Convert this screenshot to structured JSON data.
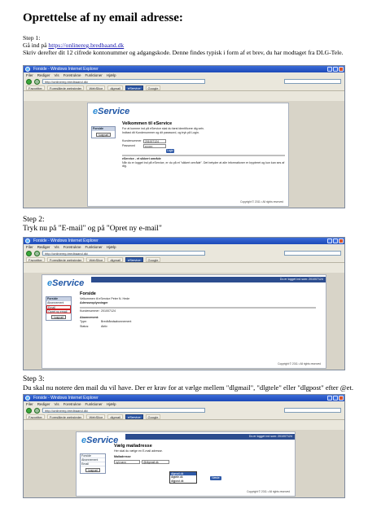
{
  "doc": {
    "title": "Oprettelse af ny email adresse:",
    "step1": {
      "heading": "Step 1:",
      "line1_prefix": "Gå ind på ",
      "link": "https://onlinereg.bredbaand.dk",
      "line2": "Skriv derefter dit 12 cifrede kontonummer og adgangskode. Denne findes typisk i form af et brev, du har modtaget fra DLG-Tele."
    },
    "step2": {
      "heading": "Step 2:",
      "instruction": "Tryk nu på \"E-mail\" og på \"Opret ny e-mail\""
    },
    "step3": {
      "heading": "Step 3:",
      "instruction": "Du skal nu notere den mail du vil have. Der er krav for at vælge mellem \"dlgmail\", \"dlgtele\" eller \"dlgpost\" efter @et."
    }
  },
  "browser": {
    "window_title": "Forside - Windows Internet Explorer",
    "menu": [
      "Filer",
      "Rediger",
      "Vis",
      "Foretrukne",
      "Funktioner",
      "Hjælp"
    ],
    "address": "http://onlinereg.bredbaand.dk/",
    "links": [
      "Favoritter",
      "Foreslåede websteder",
      "WebSlice",
      "dlgmail"
    ],
    "tabs": [
      "eService",
      "Google"
    ]
  },
  "shot1": {
    "logo_e": "e",
    "logo_rest": "Service",
    "side_head": "Forside",
    "logout": "Log ud",
    "welcome": "Velkommen til eService",
    "intro": "For at komme ind på eService skal du først identificere dig selv.",
    "hint": "Indtast dit Kundenummer og dit password, og tryk på Login.",
    "label_user": "Kundenummer",
    "value_user": "201007124",
    "label_pass": "Password",
    "value_pass": "••••••••",
    "login": "Login",
    "notice_title": "eService - et sikkert område",
    "notice": "Når du er logget ind på eService, er du på et \"sikkert område\". Det betyder at alle informationer er krypteret og kun kan ses af dig.",
    "copyright": "Copyright © 2011 • All rights reserved"
  },
  "shot2": {
    "logo_e": "e",
    "logo_rest": "Service",
    "header_right": "Du er logget ind som: 201007124",
    "side": [
      "Forside",
      "Abonnement",
      "Email",
      "Opret ny email"
    ],
    "logout": "Log ud",
    "title": "Forside",
    "welcome": "Velkommen til eService Peter N. Hede",
    "section": "Adresseoplysninger",
    "label_customer": "Kundenummer:",
    "value_customer": "201007124",
    "section2": "Abonnement:",
    "type_label": "Type:",
    "type_value": "Bredbåndsabonnement",
    "status_label": "Status:",
    "status_value": "Aktiv",
    "copyright": "Copyright © 2011 • All rights reserved"
  },
  "shot3": {
    "logo_e": "e",
    "logo_rest": "Service",
    "header_right": "Du er logget ind som: 201007124",
    "side": [
      "Forside",
      "Abonnement",
      "Email"
    ],
    "logout": "Log ud",
    "title": "Vælg mailadresse",
    "intro": "Her skal du vælge en E-mail adresse.",
    "field_label": "Mailadresse",
    "field_value": "nyt.navn",
    "at_domain": "@dlgmail.dk",
    "options": [
      "dlgmail.dk",
      "dlgtele.dk",
      "dlgpost.dk"
    ],
    "next": "Næste",
    "copyright": "Copyright © 2011 • All rights reserved"
  }
}
